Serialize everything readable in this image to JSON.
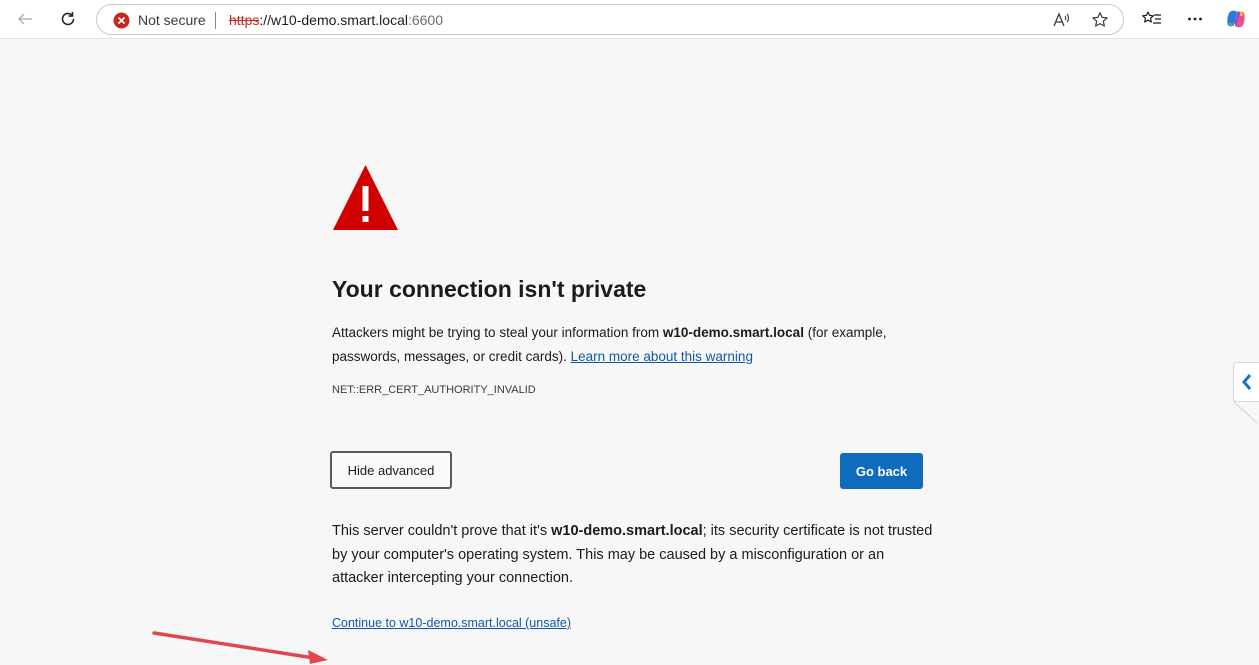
{
  "toolbar": {
    "back_icon": "back-arrow-icon",
    "refresh_icon": "refresh-icon",
    "security_status": "Not secure",
    "url_scheme": "https",
    "url_sep": "://",
    "url_host": "w10-demo.smart.local",
    "url_port": ":6600",
    "read_aloud_icon": "read-aloud-icon",
    "favorite_icon": "star-icon",
    "favorites_icon": "favorites-icon",
    "menu_icon": "more-icon",
    "copilot_icon": "copilot-icon"
  },
  "page": {
    "warning_icon": "warning-triangle-icon",
    "title": "Your connection isn't private",
    "desc_pre": "Attackers might be trying to steal your information from ",
    "desc_host": "w10-demo.smart.local",
    "desc_mid": " (for example, passwords, messages, or credit cards). ",
    "learn_more": "Learn more about this warning",
    "error_code": "NET::ERR_CERT_AUTHORITY_INVALID",
    "hide_advanced": "Hide advanced",
    "go_back": "Go back",
    "detail_pre": "This server couldn't prove that it's ",
    "detail_host": "w10-demo.smart.local",
    "detail_post": "; its security certificate is not trusted by your computer's operating system. This may be caused by a misconfiguration or an attacker intercepting your connection.",
    "continue_link": "Continue to w10-demo.smart.local (unsafe)"
  },
  "colors": {
    "warning_red": "#d00000",
    "link_blue": "#0f5aa8",
    "primary_button": "#0f6cbd",
    "annotation_arrow": "#e0464e"
  }
}
